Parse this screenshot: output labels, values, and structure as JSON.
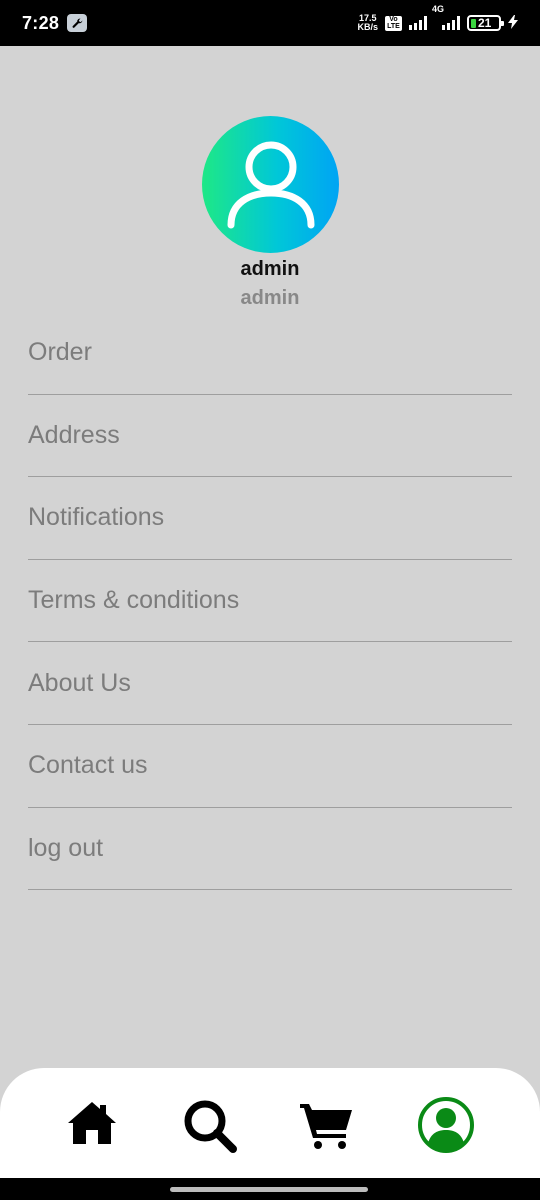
{
  "status_bar": {
    "time": "7:28",
    "speed_value": "17.5",
    "speed_unit": "KB/s",
    "volte_top": "Vo",
    "volte_bottom": "LTE",
    "network": "4G",
    "battery": "21",
    "battery_color": "#3ad640"
  },
  "profile": {
    "name": "admin",
    "subtitle": "admin",
    "gradient_start": "#1ee886",
    "gradient_end": "#00a4f4"
  },
  "menu": {
    "items": [
      {
        "label": "Order"
      },
      {
        "label": "Address"
      },
      {
        "label": "Notifications"
      },
      {
        "label": "Terms & conditions"
      },
      {
        "label": "About Us"
      },
      {
        "label": "Contact us"
      },
      {
        "label": "log out"
      }
    ]
  },
  "bottom_nav": {
    "items": [
      {
        "icon": "home-icon",
        "active": false
      },
      {
        "icon": "search-icon",
        "active": false
      },
      {
        "icon": "cart-icon",
        "active": false
      },
      {
        "icon": "profile-icon",
        "active": true
      }
    ],
    "active_color": "#0a8a16"
  }
}
